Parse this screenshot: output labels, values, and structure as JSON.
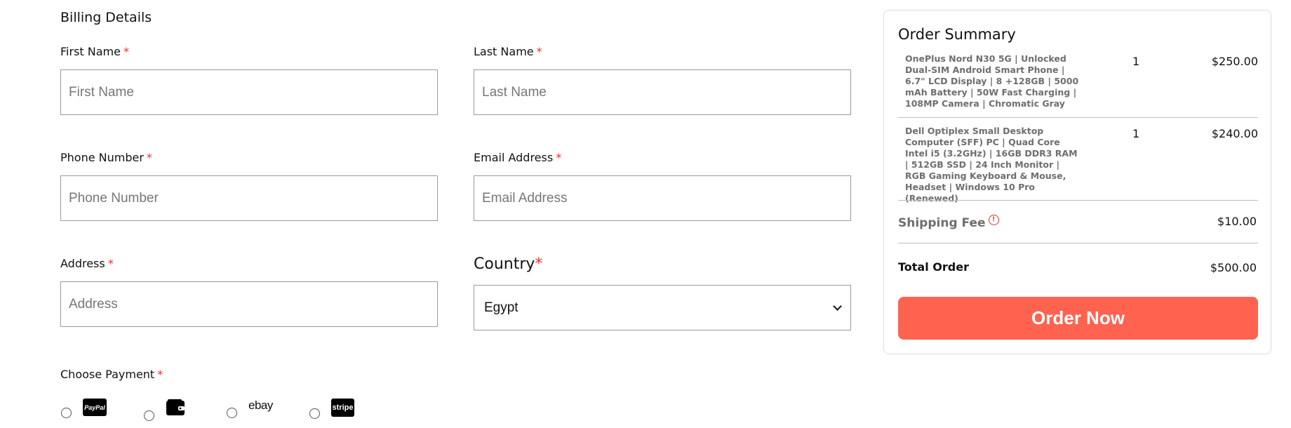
{
  "billing": {
    "title": "Billing Details",
    "required_mark": "*",
    "first_name": {
      "label": "First Name",
      "placeholder": "First Name",
      "value": ""
    },
    "last_name": {
      "label": "Last Name",
      "placeholder": "Last Name",
      "value": ""
    },
    "phone": {
      "label": "Phone Number",
      "placeholder": "Phone Number",
      "value": ""
    },
    "email": {
      "label": "Email Address",
      "placeholder": "Email Address",
      "value": ""
    },
    "address": {
      "label": "Address",
      "placeholder": "Address",
      "value": ""
    },
    "country": {
      "label": "Country",
      "selected": "Egypt"
    }
  },
  "payment": {
    "label": "Choose Payment",
    "options": [
      {
        "name": "PayPal",
        "logo_text": "PayPal",
        "icon": "paypal-logo-icon"
      },
      {
        "name": "Wallet",
        "logo_text": "",
        "icon": "wallet-icon"
      },
      {
        "name": "eBay",
        "logo_text": "ebay",
        "icon": "ebay-logo-icon"
      },
      {
        "name": "Stripe",
        "logo_text": "stripe",
        "icon": "stripe-logo-icon"
      }
    ]
  },
  "summary": {
    "title": "Order Summary",
    "items": [
      {
        "name": "OnePlus Nord N30 5G | Unlocked Dual-SIM Android Smart Phone | 6.7\" LCD Display | 8 +128GB | 5000 mAh Battery | 50W Fast Charging | 108MP Camera | Chromatic Gray",
        "qty": "1",
        "price": "$250.00"
      },
      {
        "name": "Dell Optiplex Small Desktop Computer (SFF) PC | Quad Core Intel i5 (3.2GHz) | 16GB DDR3 RAM | 512GB SSD | 24 Inch Monitor | RGB Gaming Keyboard & Mouse, Headset | Windows 10 Pro (Renewed)",
        "qty": "1",
        "price": "$240.00"
      }
    ],
    "shipping_label": "Shipping Fee",
    "shipping_info_icon": "!",
    "shipping_value": "$10.00",
    "total_label": "Total Order",
    "total_value": "$500.00",
    "order_button": "Order Now"
  },
  "colors": {
    "accent": "#ff6350",
    "required": "#e0312f",
    "border": "#9a9a9a"
  }
}
